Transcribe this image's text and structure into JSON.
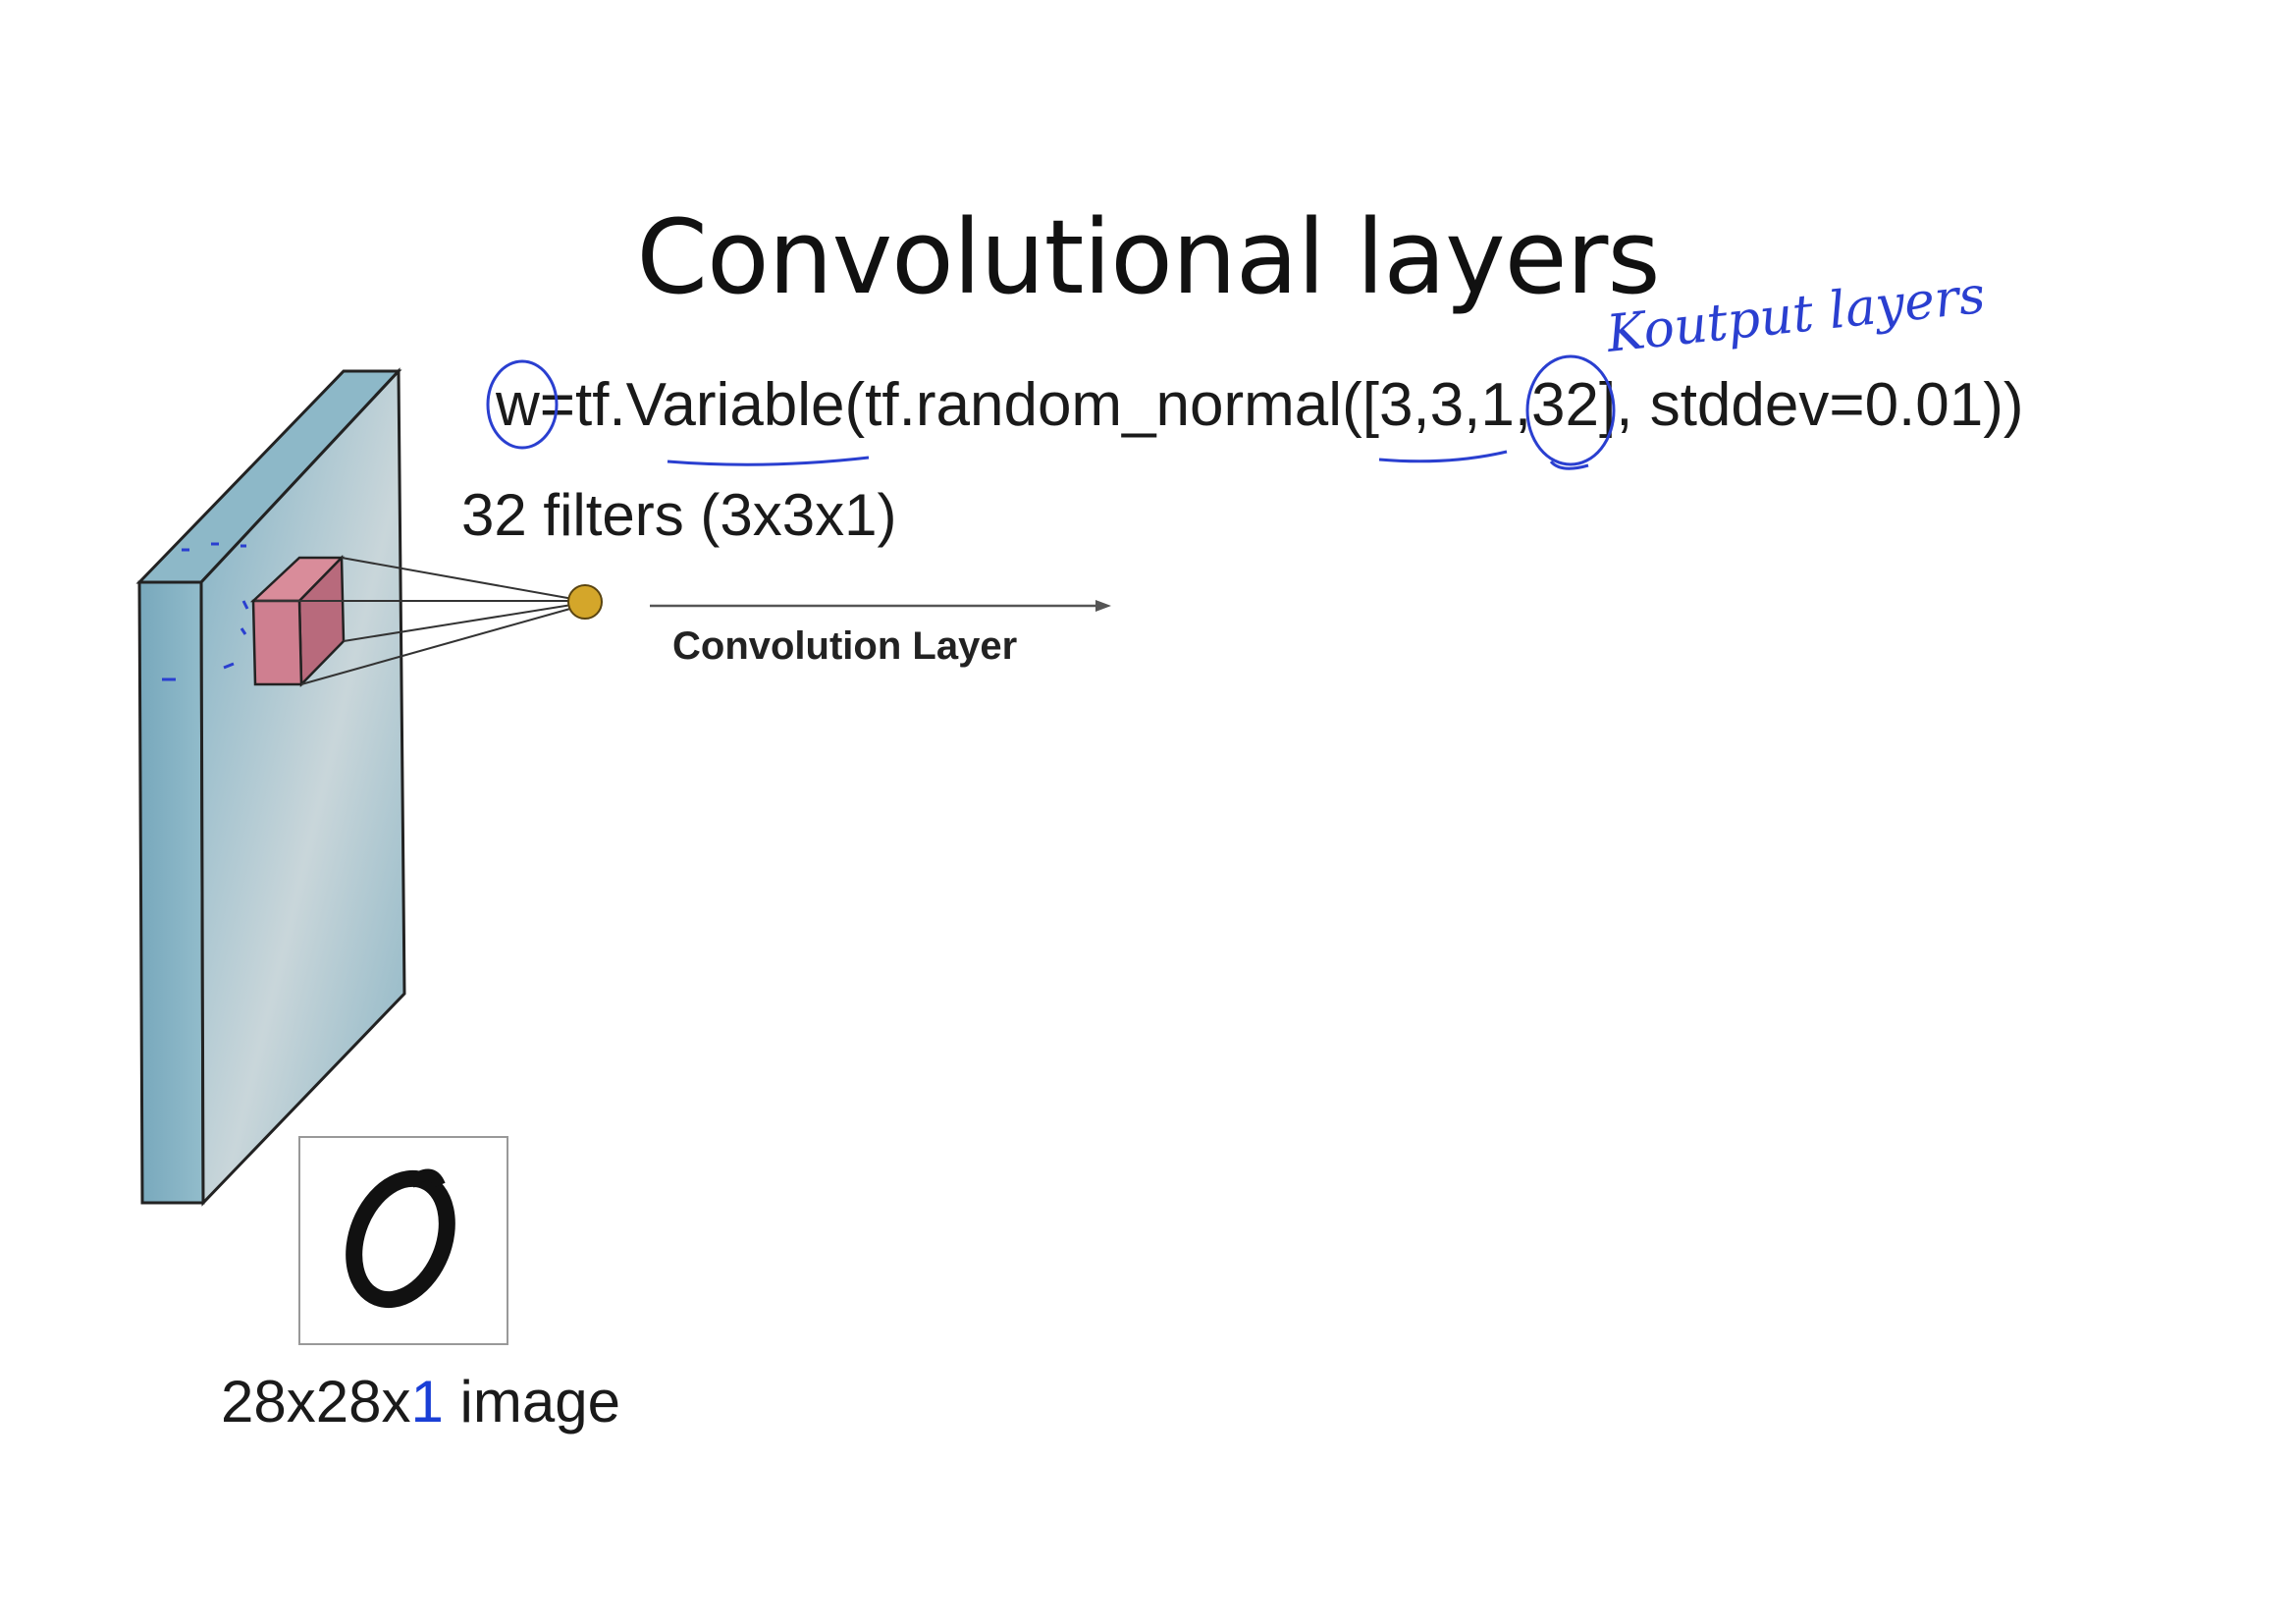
{
  "slide": {
    "title": "Convolutional layers",
    "code_line": "w=tf.Variable(tf.random_normal([3,3,1,32], stddev=0.01))",
    "filters_label": "32 filters (3x3x1)",
    "arrow_label": "Convolution Layer",
    "image_label": {
      "prefix": "28x28x",
      "highlight": "1",
      "suffix": " image"
    },
    "handwritten_annotation": "Koutput layers"
  },
  "colors": {
    "text": "#111111",
    "annotation_ink": "#2a3fd0",
    "volume_face": "#8fb6c6",
    "filter_cube": "#c87b8c",
    "neuron": "#d4a62a"
  },
  "icons": {
    "mnist_digit": "handwritten-zero-digit",
    "neuron": "output-neuron-dot"
  }
}
